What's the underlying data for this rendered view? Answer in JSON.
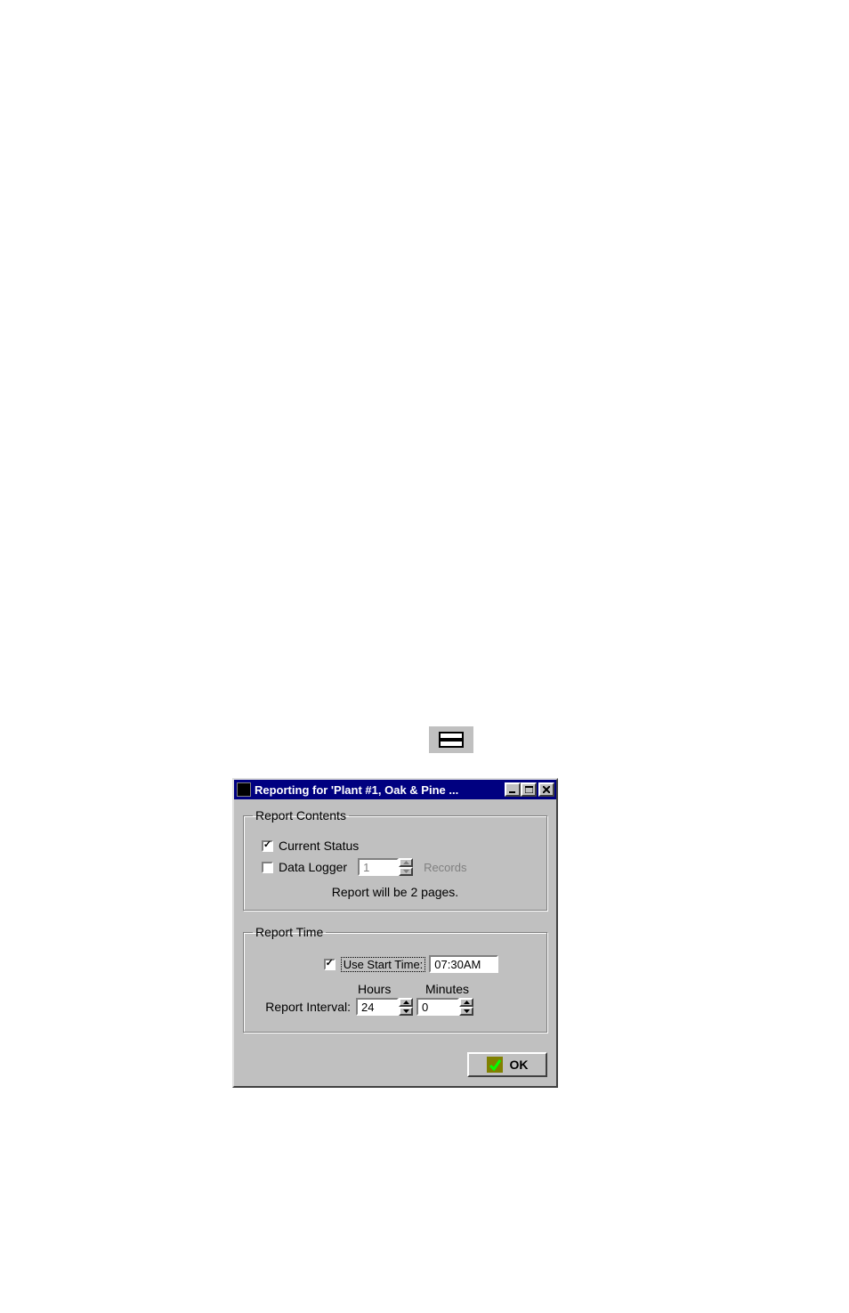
{
  "window": {
    "title": "Reporting for 'Plant #1, Oak & Pine ..."
  },
  "report_contents": {
    "legend": "Report Contents",
    "current_status_label": "Current Status",
    "current_status_checked": true,
    "data_logger_label": "Data Logger",
    "data_logger_checked": false,
    "data_logger_records_value": "1",
    "records_label": "Records",
    "summary": "Report will be 2 pages."
  },
  "report_time": {
    "legend": "Report Time",
    "use_start_time_label": "Use Start Time:",
    "use_start_time_checked": true,
    "start_time_value": "07:30AM",
    "interval_label": "Report Interval:",
    "hours_label": "Hours",
    "minutes_label": "Minutes",
    "hours_value": "24",
    "minutes_value": "0"
  },
  "buttons": {
    "ok_label": "OK"
  }
}
